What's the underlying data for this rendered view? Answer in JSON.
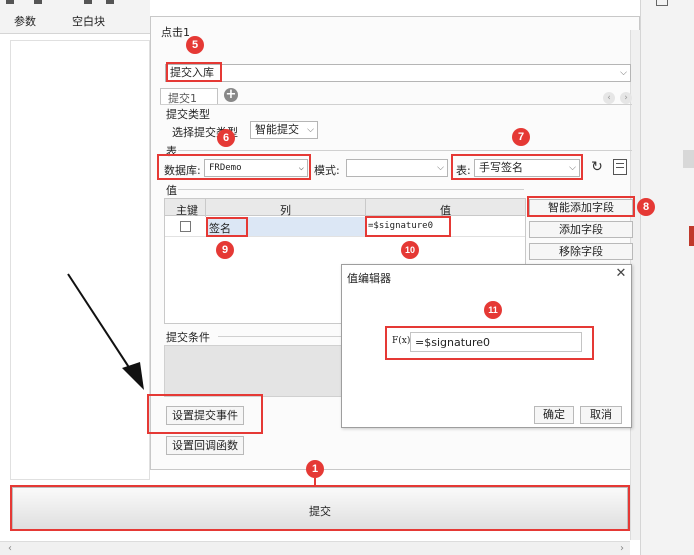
{
  "app": {
    "widget_tabs": [
      "参数",
      "空白块"
    ]
  },
  "dialog": {
    "title": "点击1",
    "action_type": "提交入库",
    "tab_label": "提交1",
    "section_submit_type": "提交类型",
    "submit_type_label": "选择提交类型",
    "submit_type_value": "智能提交",
    "section_table": "表",
    "db_label": "数据库:",
    "db_value": "FRDemo",
    "schema_label": "模式:",
    "schema_value": "",
    "table_label": "表:",
    "table_value": "手写签名",
    "section_value": "值",
    "columns": {
      "key": "主键",
      "column": "列",
      "value": "值"
    },
    "row": {
      "column": "签名",
      "value": "=$signature0"
    },
    "buttons": {
      "smart_add": "智能添加字段",
      "add": "添加字段",
      "remove": "移除字段"
    },
    "section_condition": "提交条件",
    "set_submit_event": "设置提交事件",
    "set_callback": "设置回调函数"
  },
  "value_editor": {
    "title": "值编辑器",
    "formula_icon_label": "F(x)",
    "value": "=$signature0",
    "ok": "确定",
    "cancel": "取消"
  },
  "submit_button_label": "提交",
  "badges": [
    "1",
    "5",
    "6",
    "7",
    "8",
    "9",
    "10",
    "11"
  ],
  "colors": {
    "accent": "#e53935",
    "header_bg": "#e9e9e9",
    "selection": "#dce7f5"
  }
}
